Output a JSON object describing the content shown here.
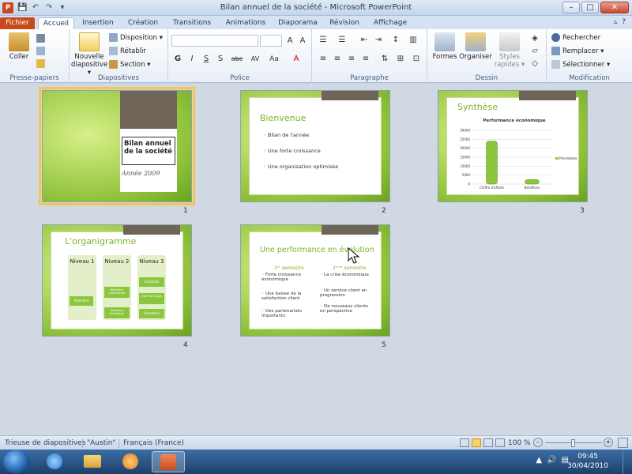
{
  "window": {
    "title": "Bilan annuel de la société - Microsoft PowerPoint",
    "app_icon_letter": "P",
    "qat": [
      "save-icon",
      "undo-icon",
      "redo-icon",
      "customize-icon"
    ],
    "qat_glyphs": [
      "💾",
      "↶",
      "↷",
      "▾"
    ],
    "minimize": "–",
    "maximize": "□",
    "close": "✕"
  },
  "tabs": {
    "items": [
      "Fichier",
      "Accueil",
      "Insertion",
      "Création",
      "Transitions",
      "Animations",
      "Diaporama",
      "Révision",
      "Affichage"
    ],
    "active": "Accueil",
    "right_glyphs": [
      "▵",
      "?"
    ]
  },
  "ribbon": {
    "clipboard": {
      "label": "Presse-papiers",
      "paste": "Coller"
    },
    "slides": {
      "label": "Diapositives",
      "new_slide": "Nouvelle diapositive",
      "new_slide_l1": "Nouvelle",
      "new_slide_l2": "diapositive ▾",
      "layout": "Disposition ▾",
      "reset": "Rétablir",
      "section": "Section ▾"
    },
    "font": {
      "label": "Police",
      "bold": "G",
      "italic": "I",
      "underline": "S",
      "strike": "S",
      "shadow": "abc",
      "spacing": "AV",
      "case": "Aa",
      "color": "A"
    },
    "paragraph": {
      "label": "Paragraphe"
    },
    "drawing": {
      "label": "Dessin",
      "shapes": "Formes",
      "arrange": "Organiser",
      "styles_l1": "Styles",
      "styles_l2": "rapides ▾"
    },
    "editing": {
      "label": "Modification",
      "find": "Rechercher",
      "replace": "Remplacer ▾",
      "select": "Sélectionner ▾"
    }
  },
  "slides": [
    {
      "num": "1",
      "title": "Bilan annuel de la société",
      "title_l1": "Bilan annuel",
      "title_l2": "de la société",
      "subtitle": "Année 2009"
    },
    {
      "num": "2",
      "title": "Bienvenue",
      "bullets": [
        "Bilan de l'année",
        "Une forte croissance",
        "Une organisation optimisée"
      ]
    },
    {
      "num": "3",
      "title": "Synthèse",
      "chart_title": "Performance économique",
      "legend": "Précédente",
      "categories": [
        "Chiffre d'affaire",
        "Bénéfices"
      ],
      "yticks": [
        "30000",
        "25000",
        "20000",
        "15000",
        "10000",
        "5000",
        "0"
      ]
    },
    {
      "num": "4",
      "title": "L'organigramme",
      "levels": [
        "Niveau 1",
        "Niveau 2",
        "Niveau 3"
      ],
      "boxes": [
        "Président",
        "Directeur commercial",
        "Directeur technique",
        "Assistant",
        "Chef de projet",
        "Formateur"
      ]
    },
    {
      "num": "5",
      "title": "Une performance en évolution",
      "col1_head": "1ᵉʳ semestre",
      "col2_head": "2ᵉᵐᵉ semestre",
      "col1": [
        "Forte croissance économique",
        "Une baisse de la satisfaction client",
        "Des partenariats importants"
      ],
      "col2": [
        "La crise économique",
        "Un service client en progression",
        "De nouveaux clients en perspective"
      ]
    }
  ],
  "chart_data": {
    "type": "bar",
    "title": "Performance économique",
    "categories": [
      "Chiffre d'affaire",
      "Bénéfices"
    ],
    "series": [
      {
        "name": "Précédente",
        "values": [
          24000,
          2500
        ]
      }
    ],
    "ylim": [
      0,
      30000
    ]
  },
  "statusbar": {
    "view": "Trieuse de diapositives",
    "theme": "\"Austin\"",
    "language": "Français (France)",
    "zoom": "100 %",
    "zoom_minus": "–",
    "zoom_plus": "+"
  },
  "taskbar": {
    "time": "09:45",
    "date": "30/04/2010",
    "tray_glyphs": [
      "▲",
      "🔊",
      "▤"
    ]
  }
}
